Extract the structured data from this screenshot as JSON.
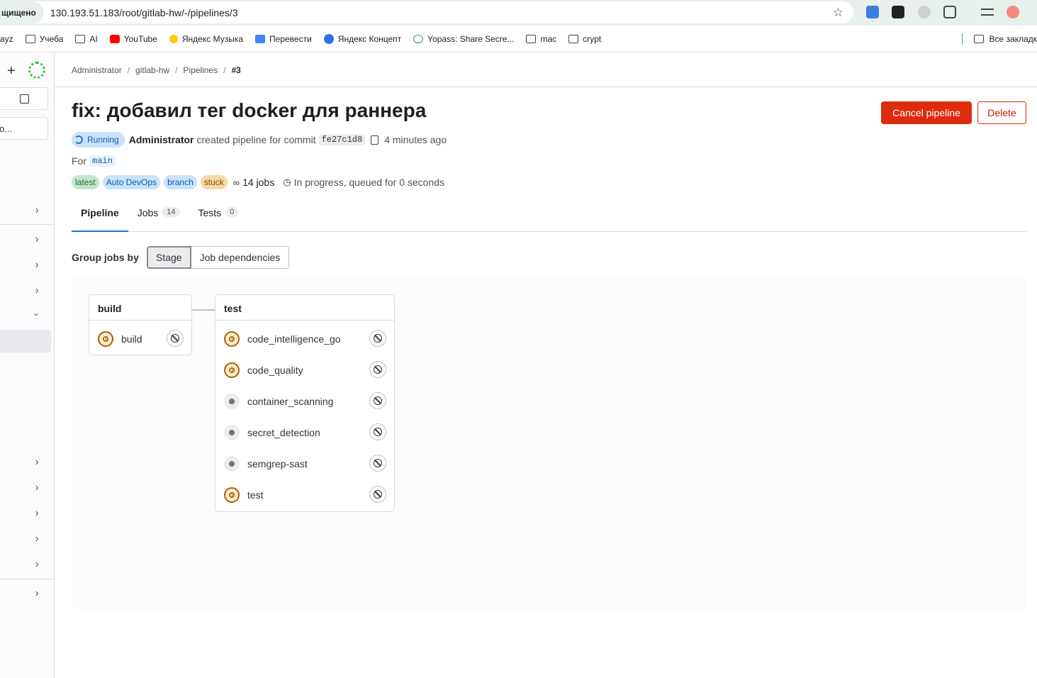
{
  "browser": {
    "secure_label": "щищено",
    "url": "130.193.51.183/root/gitlab-hw/-/pipelines/3",
    "bookmarks": [
      "ayz",
      "Учеба",
      "AI",
      "YouTube",
      "Яндекс Музыка",
      "Перевести",
      "Яндекс Концепт",
      "Yopass: Share Secre...",
      "mac",
      "crypt"
    ],
    "bookmarks_right": "Все закладк"
  },
  "sidebar": {
    "search_placeholder": "o..."
  },
  "breadcrumb": [
    "Administrator",
    "gitlab-hw",
    "Pipelines",
    "#3"
  ],
  "page": {
    "title": "fix: добавил тег docker для раннера",
    "cancel_label": "Cancel pipeline",
    "delete_label": "Delete"
  },
  "meta": {
    "status": "Running",
    "author": "Administrator",
    "action": "created pipeline for commit",
    "sha": "fe27c1d8",
    "time": "4 minutes ago",
    "for_label": "For",
    "ref": "main"
  },
  "badges": {
    "items": [
      "latest",
      "Auto DevOps",
      "branch",
      "stuck"
    ],
    "jobs": "14 jobs",
    "timer": "In progress, queued for 0 seconds"
  },
  "tabs": [
    {
      "label": "Pipeline",
      "count": ""
    },
    {
      "label": "Jobs",
      "count": "14"
    },
    {
      "label": "Tests",
      "count": "0"
    }
  ],
  "group": {
    "label": "Group jobs by",
    "stage": "Stage",
    "deps": "Job dependencies"
  },
  "stages": [
    {
      "name": "build",
      "jobs": [
        {
          "name": "build",
          "status": "paused"
        }
      ]
    },
    {
      "name": "test",
      "jobs": [
        {
          "name": "code_intelligence_go",
          "status": "paused"
        },
        {
          "name": "code_quality",
          "status": "paused"
        },
        {
          "name": "container_scanning",
          "status": "created"
        },
        {
          "name": "secret_detection",
          "status": "created"
        },
        {
          "name": "semgrep-sast",
          "status": "created"
        },
        {
          "name": "test",
          "status": "paused"
        }
      ]
    }
  ],
  "colors": {
    "danger": "#dd2b0e",
    "running": "#1f75cb",
    "paused": "#ab6100"
  }
}
